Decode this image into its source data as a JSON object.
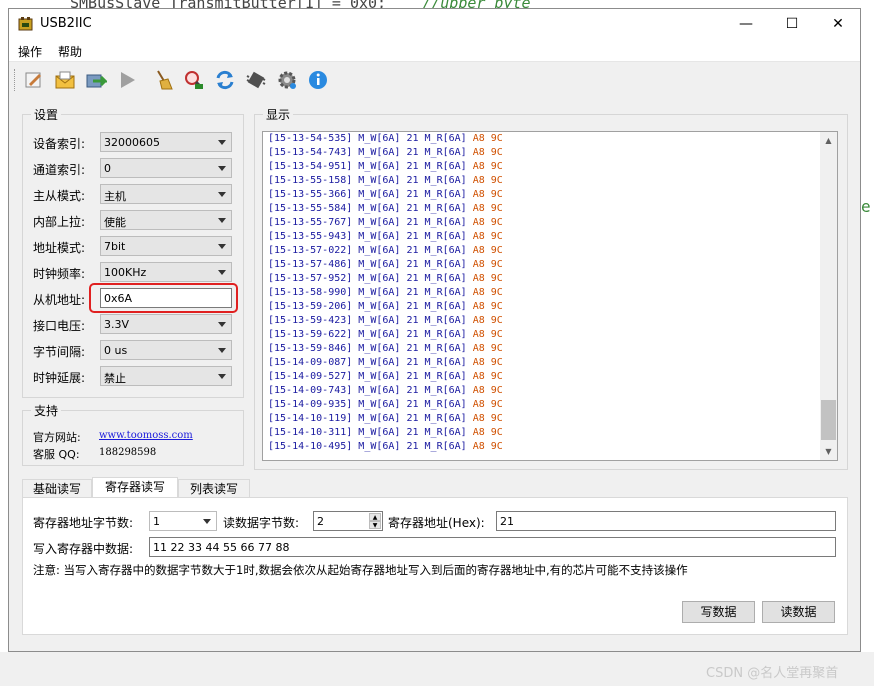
{
  "background": {
    "code_text": "SMBusSlave_TransmitButter[1] = 0x0;",
    "code_comment": "//upper byte",
    "code_fragment": "e",
    "watermark": "CSDN @名人堂再聚首"
  },
  "window": {
    "title": "USB2IIC",
    "controls": [
      "—",
      "☐",
      "✕"
    ]
  },
  "menu": [
    "操作",
    "帮助"
  ],
  "toolbar": [
    {
      "name": "edit-icon",
      "color": "#c77b3a"
    },
    {
      "name": "open-envelope-icon",
      "color": "#e0a020"
    },
    {
      "name": "export-icon",
      "color": "#3a9a3a"
    },
    {
      "name": "play-icon",
      "color": "#9a9a9a"
    },
    {
      "name": "broom-icon",
      "color": "#d8a030"
    },
    {
      "name": "search-device-icon",
      "color": "#c03030"
    },
    {
      "name": "refresh-icon",
      "color": "#2a7fd0"
    },
    {
      "name": "chip-icon",
      "color": "#505050"
    },
    {
      "name": "gear-icon",
      "color": "#6a6a6a"
    },
    {
      "name": "info-icon",
      "color": "#2a8ae0"
    }
  ],
  "settings": {
    "title": "设置",
    "fields": [
      {
        "label": "设备索引:",
        "value": "32000605"
      },
      {
        "label": "通道索引:",
        "value": "0"
      },
      {
        "label": "主从模式:",
        "value": "主机"
      },
      {
        "label": "内部上拉:",
        "value": "使能"
      },
      {
        "label": "地址模式:",
        "value": "7bit"
      },
      {
        "label": "时钟频率:",
        "value": "100KHz"
      },
      {
        "label": "从机地址:",
        "value": "0x6A"
      },
      {
        "label": "接口电压:",
        "value": "3.3V"
      },
      {
        "label": "字节间隔:",
        "value": "0 us"
      },
      {
        "label": "时钟延展:",
        "value": "禁止"
      }
    ]
  },
  "support": {
    "title": "支持",
    "website_label": "官方网站:",
    "website": "www.toomoss.com",
    "qq_label": "客服  QQ:",
    "qq": "188298598"
  },
  "display": {
    "title": "显示",
    "lines": [
      {
        "ts": "[15-13-54-535]",
        "hex": "A8 9C"
      },
      {
        "ts": "[15-13-54-743]",
        "hex": "A8 9C"
      },
      {
        "ts": "[15-13-54-951]",
        "hex": "A8 9C"
      },
      {
        "ts": "[15-13-55-158]",
        "hex": "A8 9C"
      },
      {
        "ts": "[15-13-55-366]",
        "hex": "A8 9C"
      },
      {
        "ts": "[15-13-55-584]",
        "hex": "A8 9C"
      },
      {
        "ts": "[15-13-55-767]",
        "hex": "A8 9C"
      },
      {
        "ts": "[15-13-55-943]",
        "hex": "A8 9C"
      },
      {
        "ts": "[15-13-57-022]",
        "hex": "A8 9C"
      },
      {
        "ts": "[15-13-57-486]",
        "hex": "A8 9C"
      },
      {
        "ts": "[15-13-57-952]",
        "hex": "A8 9C"
      },
      {
        "ts": "[15-13-58-990]",
        "hex": "A8 9C"
      },
      {
        "ts": "[15-13-59-206]",
        "hex": "A8 9C"
      },
      {
        "ts": "[15-13-59-423]",
        "hex": "A8 9C"
      },
      {
        "ts": "[15-13-59-622]",
        "hex": "A8 9C"
      },
      {
        "ts": "[15-13-59-846]",
        "hex": "A8 9C"
      },
      {
        "ts": "[15-14-09-087]",
        "hex": "A8 9C"
      },
      {
        "ts": "[15-14-09-527]",
        "hex": "A8 9C"
      },
      {
        "ts": "[15-14-09-743]",
        "hex": "A8 9C"
      },
      {
        "ts": "[15-14-09-935]",
        "hex": "A8 9C"
      },
      {
        "ts": "[15-14-10-119]",
        "hex": "A8 9C"
      },
      {
        "ts": "[15-14-10-311]",
        "hex": "A8 9C"
      },
      {
        "ts": "[15-14-10-495]",
        "hex": "A8 9C"
      }
    ],
    "mid": " M_W[6A] 21 M_R[6A] "
  },
  "tabs": [
    "基础读写",
    "寄存器读写",
    "列表读写"
  ],
  "register": {
    "addr_bytes_label": "寄存器地址字节数:",
    "addr_bytes_value": "1",
    "read_bytes_label": "读数据字节数:",
    "read_bytes_value": "2",
    "reg_addr_label": "寄存器地址(Hex):",
    "reg_addr_value": "21",
    "write_data_label": "写入寄存器中数据:",
    "write_data_value": "11 22 33 44 55 66 77 88",
    "note": "注意: 当写入寄存器中的数据字节数大于1时,数据会依次从起始寄存器地址写入到后面的寄存器地址中,有的芯片可能不支持该操作",
    "write_button": "写数据",
    "read_button": "读数据"
  }
}
